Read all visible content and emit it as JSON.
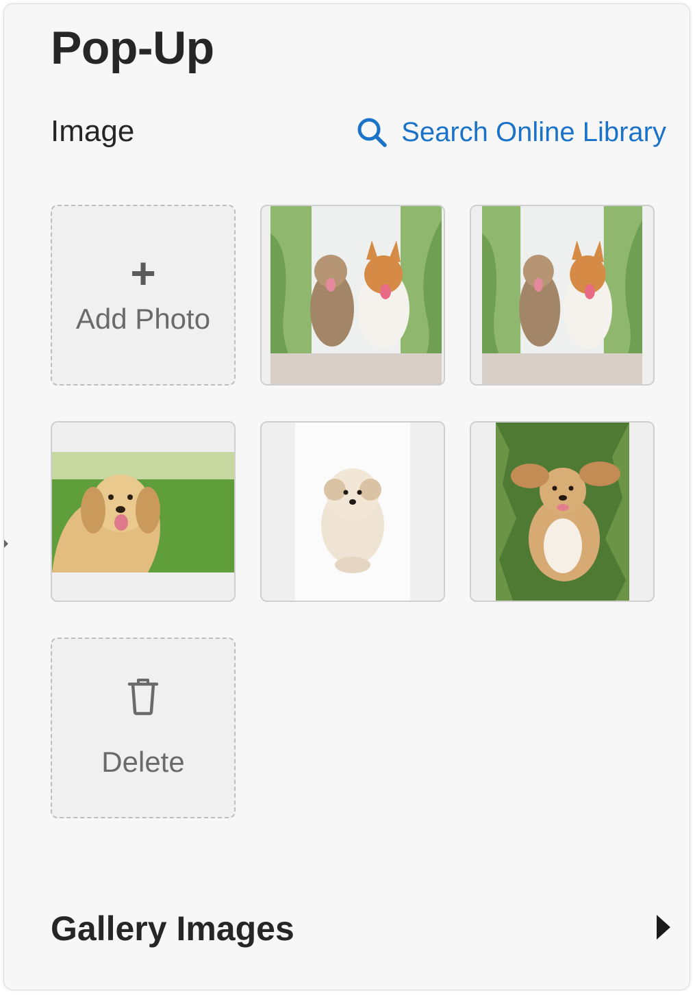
{
  "panel": {
    "title": "Pop-Up",
    "image_section": {
      "label": "Image",
      "search_link": {
        "label": "Search Online Library",
        "icon": "search-icon"
      }
    },
    "tiles": {
      "add": {
        "label": "Add Photo",
        "icon": "plus-icon"
      },
      "photos": [
        {
          "subject": "terrier and corgi walking on path",
          "icon": "photo-thumbnail"
        },
        {
          "subject": "terrier and corgi walking on path",
          "icon": "photo-thumbnail"
        },
        {
          "subject": "golden retriever on grass",
          "icon": "photo-thumbnail"
        },
        {
          "subject": "fluffy white puppy",
          "icon": "photo-thumbnail"
        },
        {
          "subject": "spaniel lying on grass",
          "icon": "photo-thumbnail"
        }
      ],
      "delete": {
        "label": "Delete",
        "icon": "trash-icon"
      }
    },
    "gallery_section": {
      "label": "Gallery Images",
      "icon": "chevron-right-icon"
    }
  },
  "colors": {
    "accent": "#1a73c9",
    "text": "#262626",
    "panel_bg": "#f7f7f7",
    "tile_bg": "#f0f0f0"
  }
}
